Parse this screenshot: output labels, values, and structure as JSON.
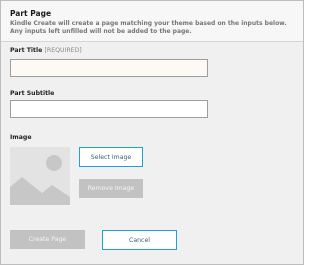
{
  "panel": {
    "title": "Part Page",
    "description": "Kindle Create will create a page matching your theme based on the inputs below. Any inputs left unfilled will not be added to the page."
  },
  "fields": {
    "part_title": {
      "label": "Part Title",
      "required_tag": "[REQUIRED]",
      "value": ""
    },
    "part_subtitle": {
      "label": "Part Subtitle",
      "value": ""
    }
  },
  "image": {
    "label": "Image",
    "thumbnail_icon": "image-placeholder-icon",
    "select_label": "Select Image",
    "remove_label": "Remove Image"
  },
  "actions": {
    "create_label": "Create Page",
    "cancel_label": "Cancel"
  },
  "colors": {
    "accent_border": "#1e9fd8",
    "disabled_button": "#c2c2c2",
    "panel_background": "#f0f0f0"
  }
}
